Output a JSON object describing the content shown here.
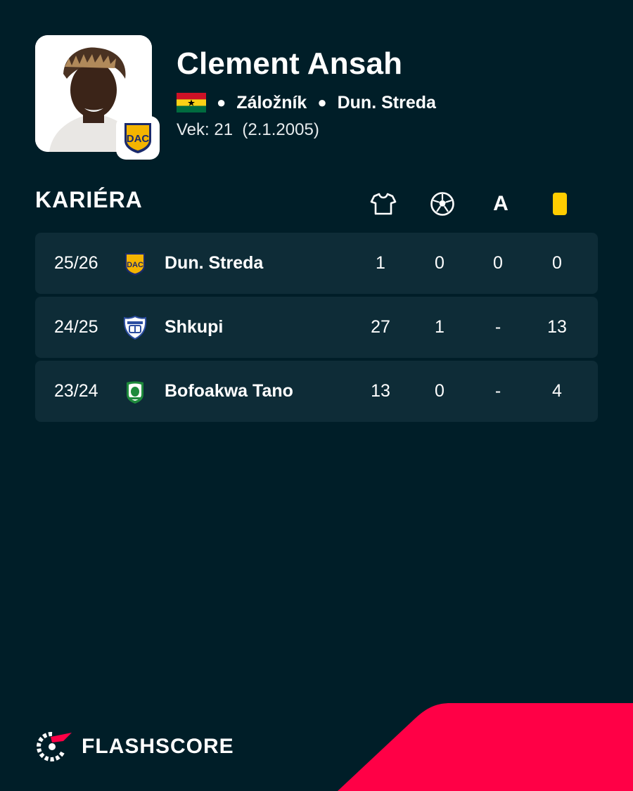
{
  "player": {
    "name": "Clement Ansah",
    "position": "Záložník",
    "club": "Dun. Streda",
    "age_label": "Vek: 21",
    "birthdate": "(2.1.2005)",
    "flag": "ghana-flag-icon",
    "club_badge": "dac-crest-icon"
  },
  "career": {
    "title": "KARIÉRA",
    "columns": [
      {
        "icon": "shirt-icon",
        "meaning": "appearances"
      },
      {
        "icon": "football-icon",
        "meaning": "goals"
      },
      {
        "label": "A",
        "meaning": "assists"
      },
      {
        "icon": "yellow-card-icon",
        "meaning": "yellow cards"
      }
    ],
    "rows": [
      {
        "season": "25/26",
        "team": "Dun. Streda",
        "logo": "dac-crest-icon",
        "apps": "1",
        "goals": "0",
        "assists": "0",
        "yellow": "0"
      },
      {
        "season": "24/25",
        "team": "Shkupi",
        "logo": "shkupi-crest-icon",
        "apps": "27",
        "goals": "1",
        "assists": "-",
        "yellow": "13"
      },
      {
        "season": "23/24",
        "team": "Bofoakwa Tano",
        "logo": "bofoakwa-crest-icon",
        "apps": "13",
        "goals": "0",
        "assists": "-",
        "yellow": "4"
      }
    ]
  },
  "brand": {
    "name": "FLASHSCORE",
    "logo": "flashscore-logo-icon"
  },
  "colors": {
    "background": "#001e28",
    "row": "#0e2c37",
    "accent": "#ff0046",
    "yellow_card": "#ffcd00",
    "dac_gold": "#f4b400",
    "dac_blue": "#1a2a6c"
  }
}
